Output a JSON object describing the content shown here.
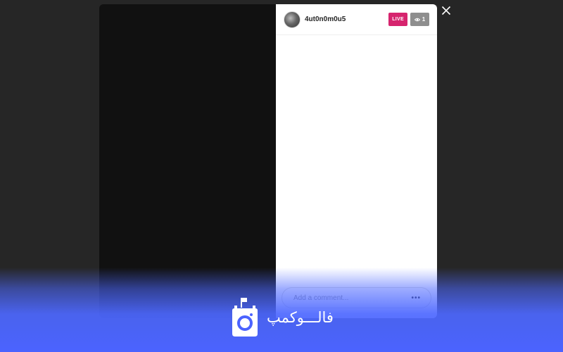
{
  "stream": {
    "username": "4ut0n0m0u5",
    "live_label": "LIVE",
    "viewer_count": "1"
  },
  "comment": {
    "placeholder": "Add a comment..."
  },
  "icons": {
    "close": "close-icon",
    "more": "more-icon",
    "eye": "eye-icon",
    "logo": "brand-logo-icon"
  },
  "colors": {
    "live": "#d6246e",
    "viewer": "#8e8e8e",
    "brand_overlay": "#4b63ff"
  },
  "brand": {
    "name": "فالـــوکمپ"
  }
}
